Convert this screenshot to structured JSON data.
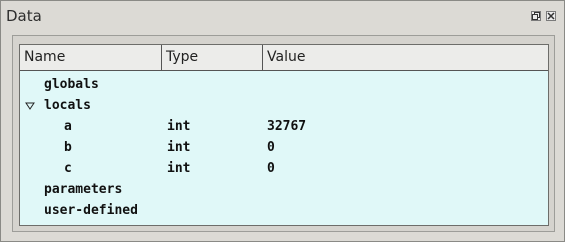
{
  "window": {
    "title": "Data"
  },
  "columns": [
    "Name",
    "Type",
    "Value"
  ],
  "rows": [
    {
      "name": "globals",
      "type": "",
      "value": "",
      "expanded": false
    },
    {
      "name": "locals",
      "type": "",
      "value": "",
      "expanded": true
    },
    {
      "name": "a",
      "type": "int",
      "value": "32767"
    },
    {
      "name": "b",
      "type": "int",
      "value": "0"
    },
    {
      "name": "c",
      "type": "int",
      "value": "0"
    },
    {
      "name": "parameters",
      "type": "",
      "value": ""
    },
    {
      "name": "user-defined",
      "type": "",
      "value": ""
    }
  ]
}
